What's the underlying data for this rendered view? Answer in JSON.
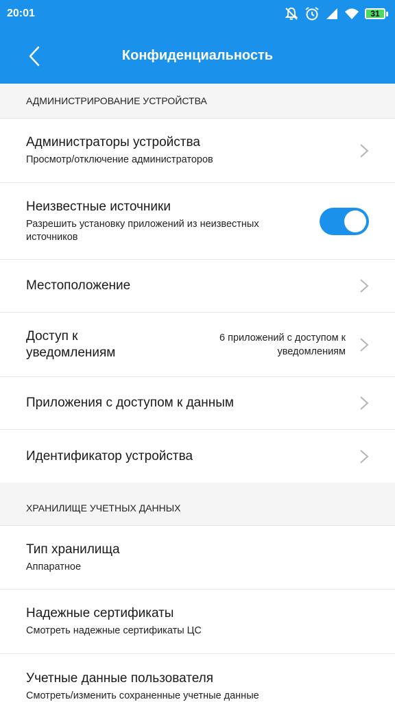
{
  "status_bar": {
    "time": "20:01",
    "battery": "31",
    "icons": [
      "notifications-off-icon",
      "alarm-icon",
      "signal-icon",
      "wifi-icon",
      "battery-icon"
    ]
  },
  "app_bar": {
    "title": "Конфиденциальность",
    "back_icon": "chevron-left-icon"
  },
  "sections": [
    {
      "header": "АДМИНИСТРИРОВАНИЕ УСТРОЙСТВА",
      "items": [
        {
          "title": "Администраторы устройства",
          "subtitle": "Просмотр/отключение администраторов",
          "control": "chevron"
        },
        {
          "title": "Неизвестные источники",
          "subtitle": "Разрешить установку приложений из неизвестных источников",
          "control": "toggle",
          "toggle_on": true
        },
        {
          "title": "Местоположение",
          "control": "chevron"
        },
        {
          "title": "Доступ к уведомлениям",
          "value": "6 приложений с доступом к уведомлениям",
          "control": "chevron"
        },
        {
          "title": "Приложения с доступом к данным",
          "control": "chevron"
        },
        {
          "title": "Идентификатор устройства",
          "control": "chevron"
        }
      ]
    },
    {
      "header": "ХРАНИЛИЩЕ УЧЕТНЫХ ДАННЫХ",
      "items": [
        {
          "title": "Тип хранилища",
          "subtitle": "Аппаратное"
        },
        {
          "title": "Надежные сертификаты",
          "subtitle": "Смотреть надежные сертификаты ЦС"
        },
        {
          "title": "Учетные данные пользователя",
          "subtitle": "Смотреть/изменить сохраненные учетные данные"
        }
      ]
    }
  ],
  "colors": {
    "accent": "#1a92ec",
    "section_bg": "#f5f5f5",
    "chevron": "#b5b5b5"
  }
}
